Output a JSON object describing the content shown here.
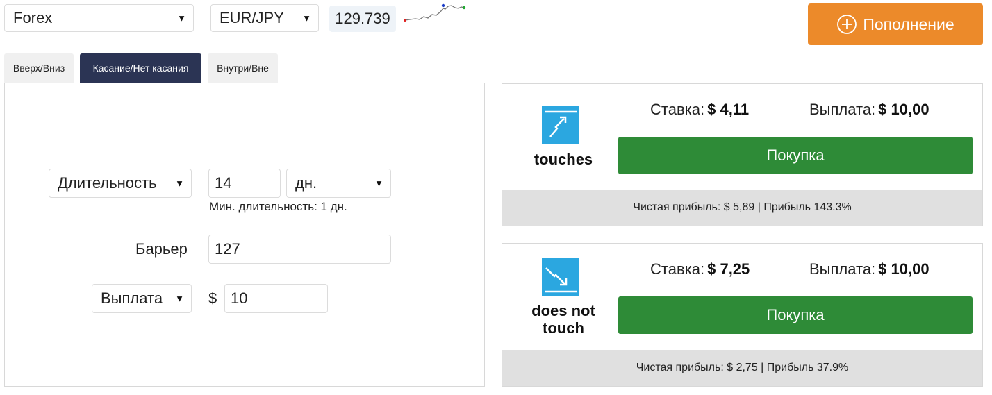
{
  "header": {
    "market_select": "Forex",
    "pair_select": "EUR/JPY",
    "current_price": "129.739",
    "deposit_label": "Пополнение"
  },
  "tabs": [
    {
      "label": "Вверх/Вниз",
      "active": false
    },
    {
      "label": "Касание/Нет касания",
      "active": true
    },
    {
      "label": "Внутри/Вне",
      "active": false
    }
  ],
  "form": {
    "duration_select": "Длительность",
    "duration_value": "14",
    "duration_unit": "дн.",
    "min_duration": "Мин. длительность: 1 дн.",
    "barrier_label": "Барьер",
    "barrier_value": "127",
    "payout_select": "Выплата",
    "currency_symbol": "$",
    "payout_value": "10"
  },
  "contracts": [
    {
      "label": "touches",
      "icon": "touches-icon",
      "stake_label": "Ставка:",
      "stake_value": "$ 4,11",
      "payout_label": "Выплата:",
      "payout_value": "$ 10,00",
      "buy_label": "Покупка",
      "footer": "Чистая прибыль: $ 5,89 | Прибыль 143.3%"
    },
    {
      "label": "does not touch",
      "icon": "does-not-touch-icon",
      "stake_label": "Ставка:",
      "stake_value": "$ 7,25",
      "payout_label": "Выплата:",
      "payout_value": "$ 10,00",
      "buy_label": "Покупка",
      "footer": "Чистая прибыль: $ 2,75 | Прибыль 37.9%"
    }
  ],
  "colors": {
    "deposit": "#ec8a2a",
    "buy": "#2e8b37",
    "active_tab": "#2b3454",
    "icon": "#2ba7e0"
  }
}
